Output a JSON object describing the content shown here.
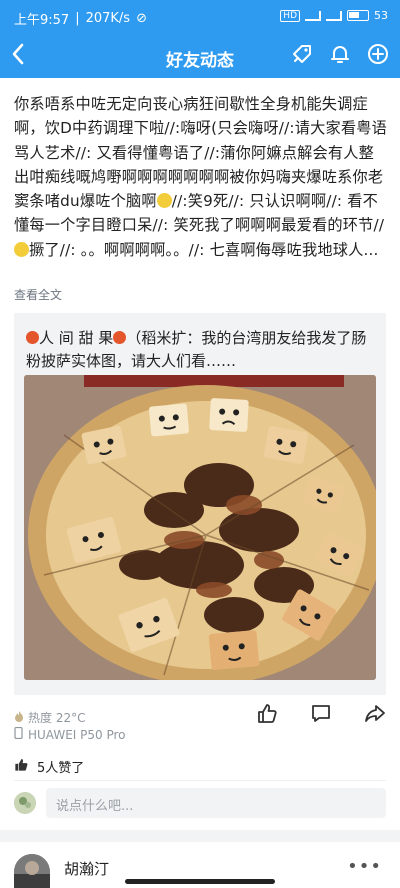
{
  "status_bar": {
    "time": "上午9:57",
    "speed": "207K/s",
    "battery": "53"
  },
  "titlebar": {
    "title": "好友动态"
  },
  "post": {
    "text_before_emoji_1": "你系唔系中咗无定向丧心病狂间歇性全身机能失调症啊，饮D中药调理下啦//:嗨呀(只会嗨呀//:请大家看粤语骂人艺术//: 又看得懂粤语了//:蒲你阿嫲点解会有人整出咁痴线嘅鸠嘢啊啊啊啊啊啊啊被你妈嗨夹爆咗系你老窦条啫du爆咗个脑啊",
    "text_after_emoji_1": "//:笑9死//: 只认识啊啊//: 看不懂每一个字目瞪口呆//: 笑死我了啊啊啊最爱看的环节//",
    "text_after_emoji_2": "撅了//: 。。啊啊啊啊。。//: 七喜啊侮辱咗我地球人...",
    "see_all": "查看全文"
  },
  "shared": {
    "source": "人 间 甜 果",
    "text": "（稻米扩：我的台湾朋友给我发了肠粉披萨实体图，请大人们看……"
  },
  "meta": {
    "heat": "热度 22°C",
    "device": "HUAWEI P50 Pro"
  },
  "likes": {
    "text": "5人赞了"
  },
  "comment": {
    "placeholder": "说点什么吧..."
  },
  "next_post": {
    "username": "胡瀚汀",
    "more": "•••"
  },
  "colors": {
    "header_blue": "#2f9bf0",
    "card_bg": "#f2f3f5"
  }
}
